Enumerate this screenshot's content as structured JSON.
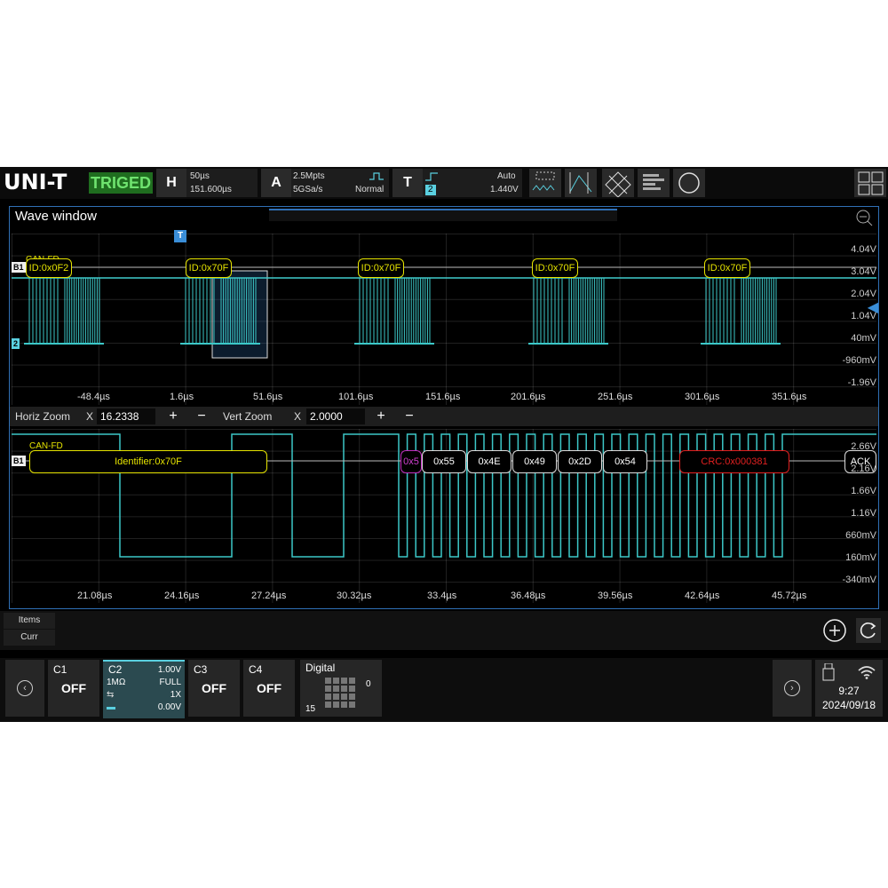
{
  "topbar": {
    "logo": "UNI-T",
    "trigger_status": "TRIGED",
    "horizontal": {
      "letter": "H",
      "timebase": "50µs",
      "delay": "151.600µs"
    },
    "acquire": {
      "letter": "A",
      "memory": "2.5Mpts",
      "sample_rate": "5GSa/s",
      "mode": "Normal"
    },
    "trigger": {
      "letter": "T",
      "source": "2",
      "sweep": "Auto",
      "level": "1.440V"
    }
  },
  "wave_window": {
    "title": "Wave window",
    "trigger_marker": "T",
    "channel_tag": "B1",
    "ch2_tag": "2",
    "protocol": "CAN-FD",
    "frames": [
      {
        "id": "ID:0x0F2"
      },
      {
        "id": "ID:0x70F"
      },
      {
        "id": "ID:0x70F"
      },
      {
        "id": "ID:0x70F"
      },
      {
        "id": "ID:0x70F"
      }
    ],
    "y_labels": [
      "4.04V",
      "3.04V",
      "2.04V",
      "1.04V",
      "40mV",
      "-960mV",
      "-1.96V"
    ],
    "x_labels": [
      "-48.4µs",
      "1.6µs",
      "51.6µs",
      "101.6µs",
      "151.6µs",
      "201.6µs",
      "251.6µs",
      "301.6µs",
      "351.6µs"
    ]
  },
  "zoom": {
    "horiz_label": "Horiz Zoom",
    "horiz_x": "X",
    "horiz_value": "16.2338",
    "vert_label": "Vert Zoom",
    "vert_x": "X",
    "vert_value": "2.0000",
    "plus": "+",
    "minus": "−"
  },
  "zoom_window": {
    "channel_tag": "B1",
    "protocol": "CAN-FD",
    "identifier": "Identifier:0x70F",
    "dlc": "0x5",
    "data_bytes": [
      "0x55",
      "0x4E",
      "0x49",
      "0x2D",
      "0x54"
    ],
    "crc": "CRC:0x000381",
    "ack": "ACK",
    "y_labels": [
      "2.66V",
      "2.16V",
      "1.66V",
      "1.16V",
      "660mV",
      "160mV",
      "-340mV"
    ],
    "x_labels": [
      "21.08µs",
      "24.16µs",
      "27.24µs",
      "30.32µs",
      "33.4µs",
      "36.48µs",
      "39.56µs",
      "42.64µs",
      "45.72µs"
    ]
  },
  "items": {
    "items_label": "Items",
    "curr_label": "Curr"
  },
  "channels": {
    "c1": {
      "name": "C1",
      "state": "OFF"
    },
    "c2": {
      "name": "C2",
      "scale": "1.00V",
      "impedance": "1MΩ",
      "bandwidth": "FULL",
      "probe": "1X",
      "offset": "0.00V"
    },
    "c3": {
      "name": "C3",
      "state": "OFF"
    },
    "c4": {
      "name": "C4",
      "state": "OFF"
    },
    "digital": {
      "name": "Digital",
      "low": "0",
      "high": "15"
    }
  },
  "status": {
    "time": "9:27",
    "date": "2024/09/18"
  },
  "colors": {
    "trace": "#3cc8c8",
    "bus": "#e6e400",
    "crc": "#e02020",
    "frame": "#2f6fb5",
    "accent": "#5ad0e0"
  }
}
